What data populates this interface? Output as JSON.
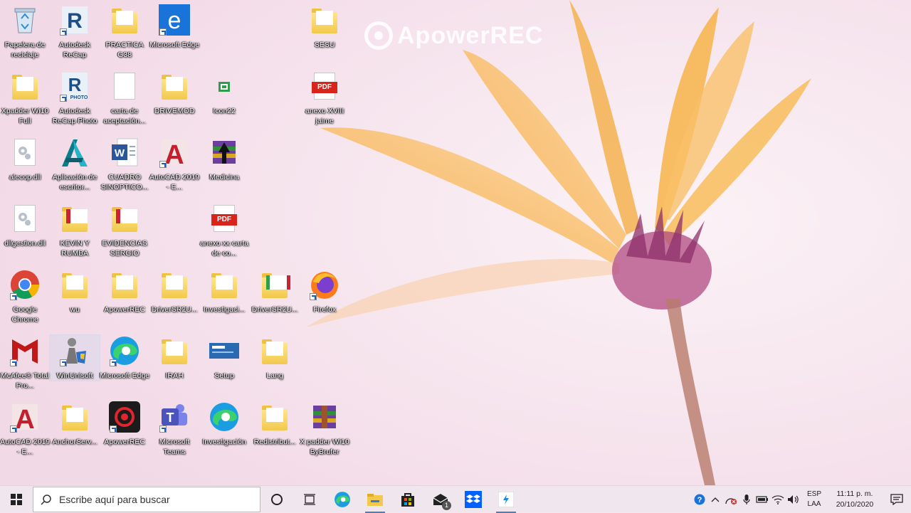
{
  "watermark": {
    "text": "ApowerREC"
  },
  "desktop_icons": [
    {
      "label": "Papelera de reciclaje",
      "icon": "recycle-bin-icon"
    },
    {
      "label": "Autodesk ReCap",
      "icon": "autodesk-recap-icon"
    },
    {
      "label": "PRACTICA G38",
      "icon": "folder-icon"
    },
    {
      "label": "Microsoft Edge",
      "icon": "edge-legacy-icon"
    },
    {
      "label": "SESU",
      "icon": "folder-icon"
    },
    {
      "label": "Xpadder Wi10 Full",
      "icon": "folder-icon"
    },
    {
      "label": "Autodesk ReCap Photo",
      "icon": "recap-photo-icon",
      "sub": "PHOTO"
    },
    {
      "label": "carta de aceptación...",
      "icon": "document-icon"
    },
    {
      "label": "DRIVEMOD",
      "icon": "folder-icon"
    },
    {
      "label": "Icon22",
      "icon": "app-icon"
    },
    {
      "label": "anexo XVIII jaime",
      "icon": "pdf-icon",
      "tag": "PDF"
    },
    {
      "label": "alecop.dll",
      "icon": "dll-icon"
    },
    {
      "label": "Aplicación de escritor...",
      "icon": "autodesk-app-icon"
    },
    {
      "label": "CUADRO SINOPTICO...",
      "icon": "word-document-icon"
    },
    {
      "label": "AutoCAD 2019 - E...",
      "icon": "autocad-icon"
    },
    {
      "label": "Medicina",
      "icon": "winrar-archive-icon"
    },
    {
      "label": "dllgestion.dll",
      "icon": "dll-icon"
    },
    {
      "label": "KEVIN Y RUMBA",
      "icon": "folder-icon"
    },
    {
      "label": "EVIDENCIAS SERGIO",
      "icon": "folder-icon"
    },
    {
      "label": "anexo xx carta de co...",
      "icon": "pdf-icon",
      "tag": "PDF"
    },
    {
      "label": "Google Chrome",
      "icon": "chrome-icon"
    },
    {
      "label": "wu",
      "icon": "folder-icon"
    },
    {
      "label": "ApowerREC",
      "icon": "folder-icon"
    },
    {
      "label": "DriverSR2U...",
      "icon": "folder-icon"
    },
    {
      "label": "Investigaci...",
      "icon": "folder-icon"
    },
    {
      "label": "DriverSR2U...",
      "icon": "folder-icon"
    },
    {
      "label": "Firefox",
      "icon": "firefox-icon"
    },
    {
      "label": "McAfee® Total Pro...",
      "icon": "mcafee-icon"
    },
    {
      "label": "WinUnisoft",
      "icon": "winunisoft-icon"
    },
    {
      "label": "Microsoft Edge",
      "icon": "edge-icon"
    },
    {
      "label": "IRAH",
      "icon": "folder-icon"
    },
    {
      "label": "Setup",
      "icon": "setup-icon"
    },
    {
      "label": "Lang",
      "icon": "folder-icon"
    },
    {
      "label": "AutoCAD 2019 - E...",
      "icon": "autocad-icon"
    },
    {
      "label": "AnchorServ...",
      "icon": "folder-icon"
    },
    {
      "label": "ApowerREC",
      "icon": "apowerrec-icon"
    },
    {
      "label": "Microsoft Teams",
      "icon": "teams-icon"
    },
    {
      "label": "Investigación",
      "icon": "edge-icon"
    },
    {
      "label": "Redistribut...",
      "icon": "folder-icon"
    },
    {
      "label": "X padder Wi10 ByBrufer",
      "icon": "winrar-archive-icon"
    }
  ],
  "taskbar": {
    "search_placeholder": "Escribe aquí para buscar",
    "apps": [
      "cortana-icon",
      "task-view-icon",
      "edge-icon",
      "file-explorer-icon",
      "store-icon",
      "mail-icon",
      "dropbox-icon",
      "app-icon"
    ],
    "mail_badge": "1"
  },
  "tray": {
    "lang_top": "ESP",
    "lang_bottom": "LAA",
    "time": "11:11 p. m.",
    "date": "20/10/2020"
  }
}
